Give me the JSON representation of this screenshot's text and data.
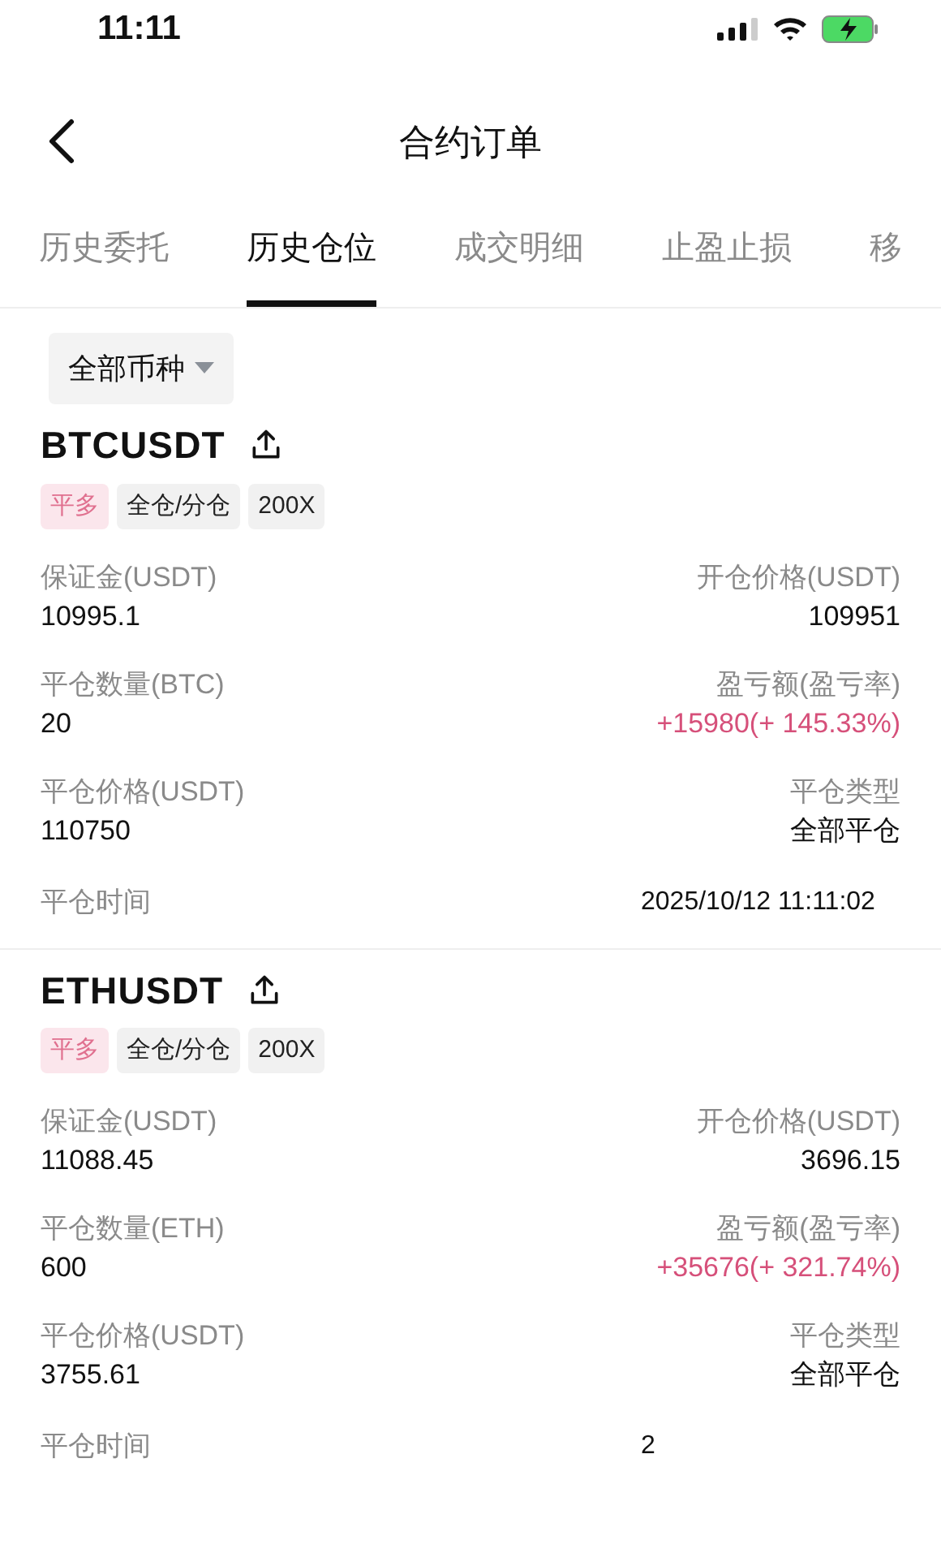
{
  "status_bar": {
    "time": "11:11"
  },
  "header": {
    "title": "合约订单"
  },
  "tabs": [
    {
      "label": "历史委托",
      "selected": false
    },
    {
      "label": "历史仓位",
      "selected": true
    },
    {
      "label": "成交明细",
      "selected": false
    },
    {
      "label": "止盈止损",
      "selected": false
    },
    {
      "label": "移",
      "selected": false
    }
  ],
  "filter": {
    "label": "全部币种"
  },
  "orders": [
    {
      "symbol": "BTCUSDT",
      "tags": [
        {
          "label": "平多",
          "kind": "side"
        },
        {
          "label": "全仓/分仓",
          "kind": "plain"
        },
        {
          "label": "200X",
          "kind": "plain"
        }
      ],
      "rows": [
        {
          "left": {
            "label": "保证金(USDT)",
            "value": "10995.1"
          },
          "right": {
            "label": "开仓价格(USDT)",
            "value": "109951",
            "kind": "plain"
          }
        },
        {
          "left": {
            "label": "平仓数量(BTC)",
            "value": "20"
          },
          "right": {
            "label": "盈亏额(盈亏率)",
            "value": "+15980(+ 145.33%)",
            "kind": "profit"
          }
        },
        {
          "left": {
            "label": "平仓价格(USDT)",
            "value": "110750"
          },
          "right": {
            "label": "平仓类型",
            "value": "全部平仓",
            "kind": "plain"
          }
        }
      ],
      "time": {
        "label": "平仓时间",
        "value": "2025/10/12 11:11:02"
      }
    },
    {
      "symbol": "ETHUSDT",
      "tags": [
        {
          "label": "平多",
          "kind": "side"
        },
        {
          "label": "全仓/分仓",
          "kind": "plain"
        },
        {
          "label": "200X",
          "kind": "plain"
        }
      ],
      "rows": [
        {
          "left": {
            "label": "保证金(USDT)",
            "value": "11088.45"
          },
          "right": {
            "label": "开仓价格(USDT)",
            "value": "3696.15",
            "kind": "plain"
          }
        },
        {
          "left": {
            "label": "平仓数量(ETH)",
            "value": "600"
          },
          "right": {
            "label": "盈亏额(盈亏率)",
            "value": "+35676(+ 321.74%)",
            "kind": "profit"
          }
        },
        {
          "left": {
            "label": "平仓价格(USDT)",
            "value": "3755.61"
          },
          "right": {
            "label": "平仓类型",
            "value": "全部平仓",
            "kind": "plain"
          }
        }
      ],
      "time": {
        "label": "平仓时间",
        "value": "2"
      }
    }
  ]
}
